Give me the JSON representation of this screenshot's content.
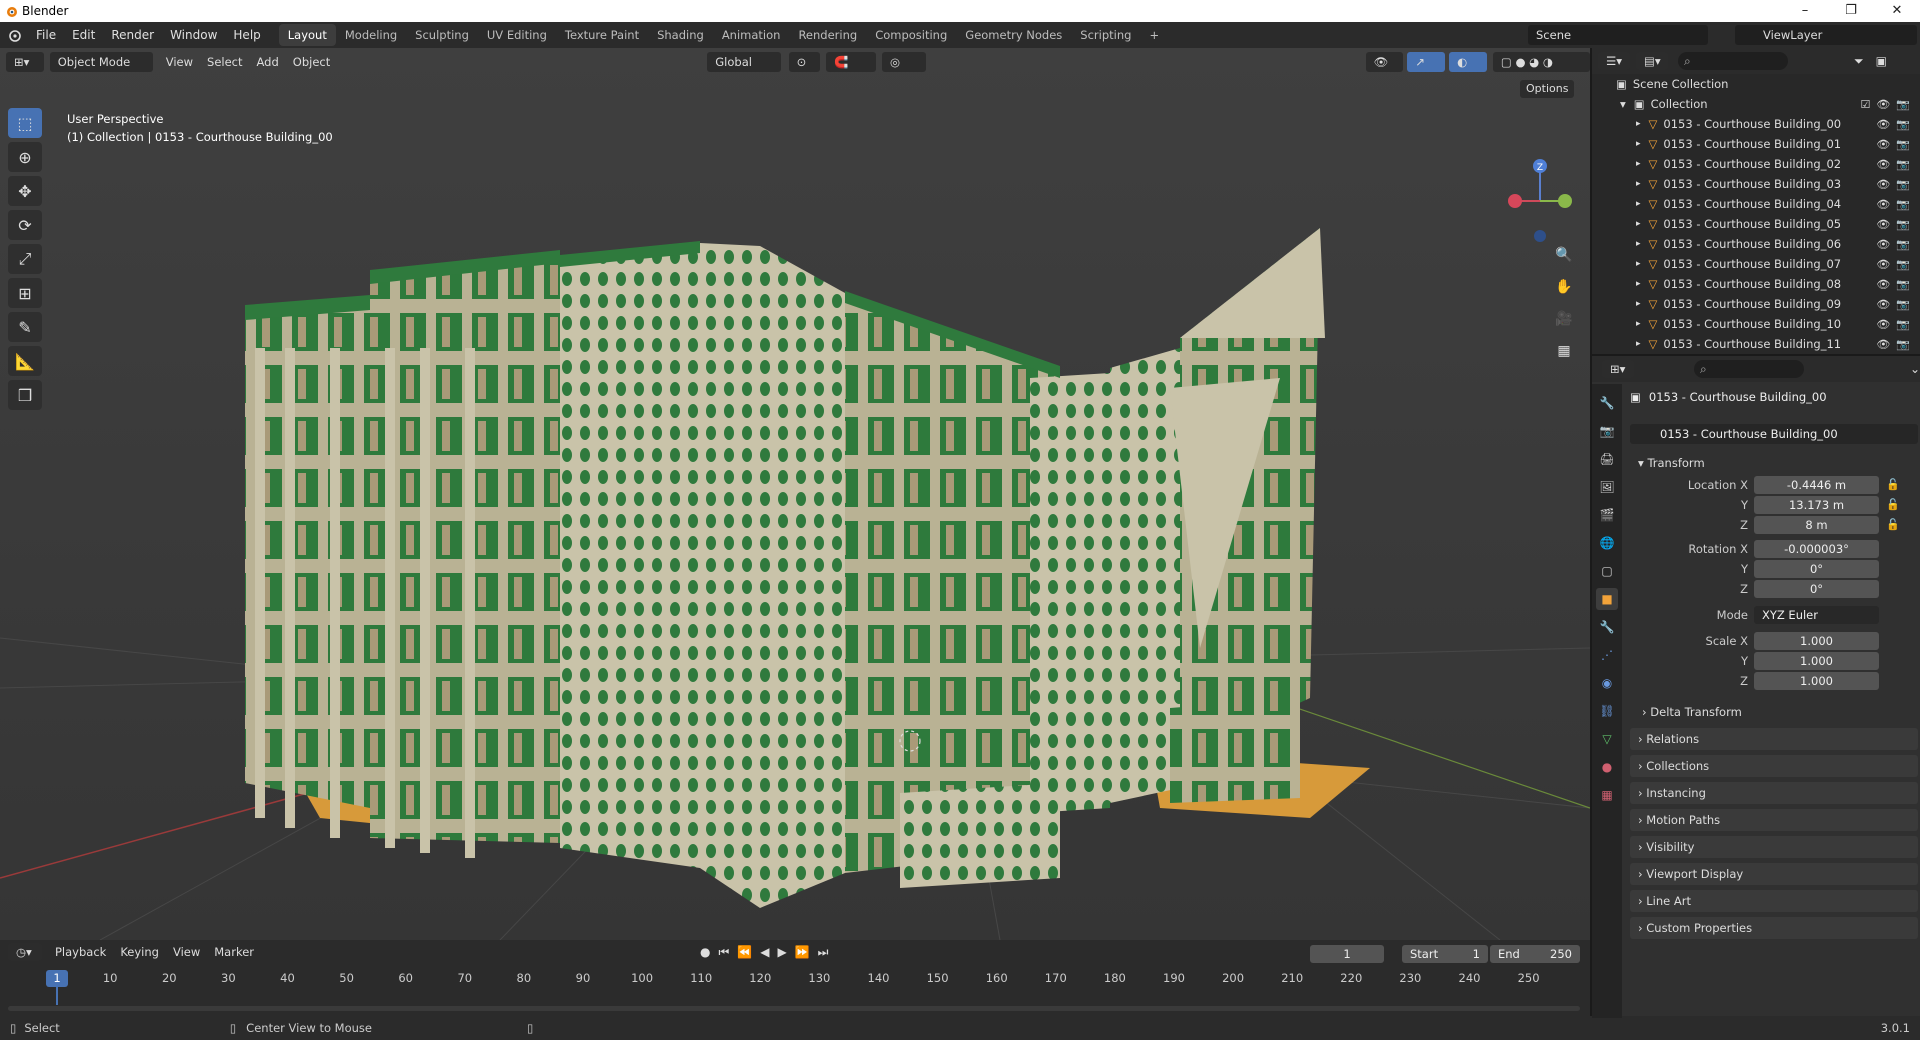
{
  "window": {
    "title": "Blender",
    "minimize": "–",
    "maximize": "❐",
    "close": "✕"
  },
  "menu": [
    "File",
    "Edit",
    "Render",
    "Window",
    "Help"
  ],
  "workspaces": [
    "Layout",
    "Modeling",
    "Sculpting",
    "UV Editing",
    "Texture Paint",
    "Shading",
    "Animation",
    "Rendering",
    "Compositing",
    "Geometry Nodes",
    "Scripting",
    "+"
  ],
  "active_workspace": "Layout",
  "scene": {
    "name": "Scene",
    "view_layer": "ViewLayer"
  },
  "viewport": {
    "mode": "Object Mode",
    "menus": [
      "View",
      "Select",
      "Add",
      "Object"
    ],
    "orientation": "Global",
    "options_label": "Options",
    "overlay_line1": "User Perspective",
    "overlay_line2": "(1) Collection | 0153 - Courthouse Building_00",
    "gizmo_z": "Z",
    "tools": [
      "select-box",
      "cursor",
      "move",
      "rotate",
      "scale",
      "transform",
      "annotate",
      "measure",
      "add-cube"
    ]
  },
  "timeline": {
    "menus": [
      "Playback",
      "Keying",
      "View",
      "Marker"
    ],
    "current_frame": "1",
    "start_label": "Start",
    "start": "1",
    "end_label": "End",
    "end": "250",
    "ruler_cur": "1",
    "ruler": [
      "10",
      "20",
      "30",
      "40",
      "50",
      "60",
      "70",
      "80",
      "90",
      "100",
      "110",
      "120",
      "130",
      "140",
      "150",
      "160",
      "170",
      "180",
      "190",
      "200",
      "210",
      "220",
      "230",
      "240",
      "250"
    ]
  },
  "status": {
    "select": "Select",
    "center": "Center View to Mouse",
    "version": "3.0.1"
  },
  "outliner": {
    "scene_collection": "Scene Collection",
    "collection": "Collection",
    "items": [
      "0153 - Courthouse Building_00",
      "0153 - Courthouse Building_01",
      "0153 - Courthouse Building_02",
      "0153 - Courthouse Building_03",
      "0153 - Courthouse Building_04",
      "0153 - Courthouse Building_05",
      "0153 - Courthouse Building_06",
      "0153 - Courthouse Building_07",
      "0153 - Courthouse Building_08",
      "0153 - Courthouse Building_09",
      "0153 - Courthouse Building_10",
      "0153 - Courthouse Building_11"
    ]
  },
  "properties": {
    "object_name": "0153 - Courthouse Building_00",
    "datablock": "0153 - Courthouse Building_00",
    "transform_label": "Transform",
    "location_x_label": "Location X",
    "location_x": "-0.4446 m",
    "y_label": "Y",
    "location_y": "13.173 m",
    "z_label": "Z",
    "location_z": "8 m",
    "rotation_x_label": "Rotation X",
    "rotation_x": "-0.000003°",
    "rotation_y": "0°",
    "rotation_z": "0°",
    "mode_label": "Mode",
    "mode": "XYZ Euler",
    "scale_x_label": "Scale X",
    "scale_x": "1.000",
    "scale_y": "1.000",
    "scale_z": "1.000",
    "panels": [
      "Delta Transform",
      "Relations",
      "Collections",
      "Instancing",
      "Motion Paths",
      "Visibility",
      "Viewport Display",
      "Line Art",
      "Custom Properties"
    ]
  },
  "colors": {
    "accent": "#4772b3",
    "building_green": "#2f7a3d",
    "building_beige": "#c8c2a8",
    "orange": "#d79a3a"
  }
}
